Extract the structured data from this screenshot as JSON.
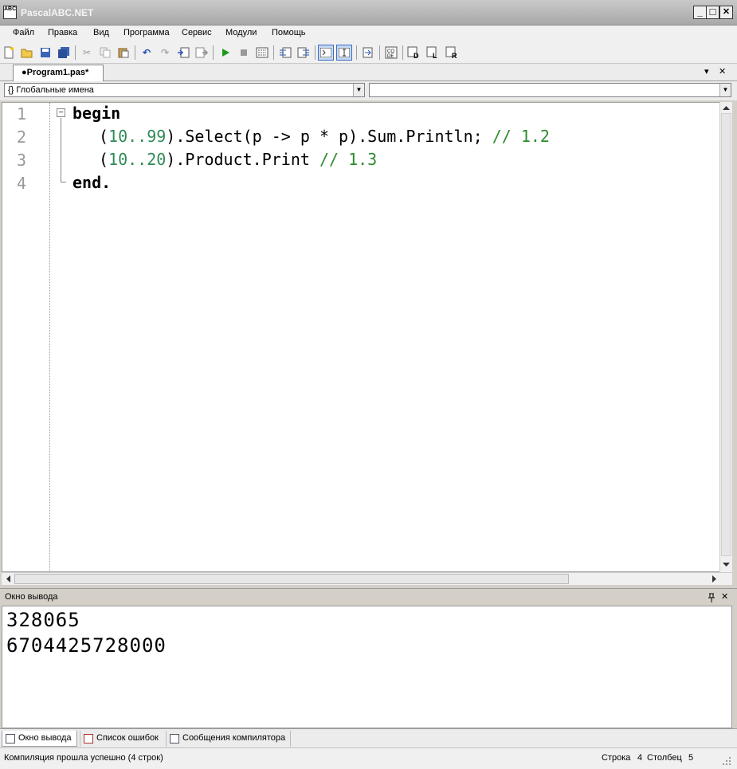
{
  "window": {
    "title": "PascalABC.NET",
    "icon_text": "ABC",
    "minimize_glyph": "_",
    "maximize_glyph": "□",
    "close_glyph": "✕"
  },
  "menu": [
    "Файл",
    "Правка",
    "Вид",
    "Программа",
    "Сервис",
    "Модули",
    "Помощь"
  ],
  "toolbar_icons": [
    "new-file-icon",
    "open-folder-icon",
    "save-icon",
    "save-all-icon",
    "cut-icon",
    "copy-icon",
    "paste-icon",
    "undo-icon",
    "redo-icon",
    "step-into-icon",
    "step-over-icon",
    "run-icon",
    "stop-icon",
    "build-icon",
    "comment-icon",
    "uncomment-icon",
    "output-toggle-icon",
    "intellisense-toggle-icon",
    "format-icon",
    "code-templates-icon",
    "debug-d-icon",
    "debug-l-icon",
    "debug-r-icon"
  ],
  "tab": {
    "label": "●Program1.pas*",
    "close_glyph": "✕",
    "menu_glyph": "▾"
  },
  "dropdowns": {
    "left": "Глобальные имена",
    "left_icon": "{}",
    "right": ""
  },
  "editor": {
    "line_numbers": [
      "1",
      "2",
      "3",
      "4"
    ],
    "lines": [
      {
        "kw": "begin"
      },
      {
        "a": "(",
        "n1": "10..99",
        "b": ").Select(p -> p * p).Sum.Println; ",
        "c": "// 1.2"
      },
      {
        "a": "(",
        "n1": "10..20",
        "b": ").Product.Print ",
        "c": "// 1.3"
      },
      {
        "kw": "end."
      }
    ],
    "fold_glyph": "−"
  },
  "output_panel": {
    "title": "Окно вывода",
    "pin_glyph": "📌",
    "close_glyph": "✕",
    "lines": [
      "328065",
      "6704425728000"
    ]
  },
  "bottom_tabs": [
    "Окно вывода",
    "Список ошибок",
    "Сообщения компилятора"
  ],
  "status": {
    "message": "Компиляция прошла успешно (4 строк)",
    "row_label": "Строка",
    "row": "4",
    "col_label": "Столбец",
    "col": "5"
  },
  "colors": {
    "number": "#2e8b57",
    "comment": "#2e8b2e",
    "title_text": "#f4f4f4"
  }
}
